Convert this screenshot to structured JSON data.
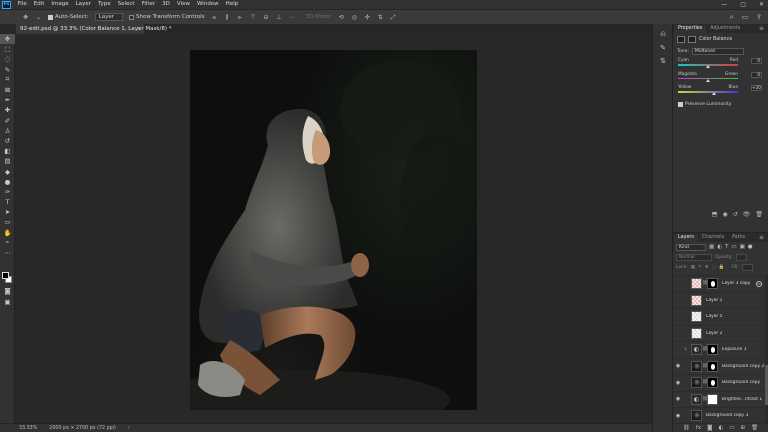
{
  "app": {
    "logo": "Ps"
  },
  "menu": [
    "File",
    "Edit",
    "Image",
    "Layer",
    "Type",
    "Select",
    "Filter",
    "3D",
    "View",
    "Window",
    "Help"
  ],
  "window_controls": [
    "—",
    "▢",
    "✕"
  ],
  "options": {
    "auto_select_label": "Auto-Select:",
    "auto_select_value": "Layer",
    "show_transform_label": "Show Transform Controls",
    "mode_3d_label": "3D Mode:",
    "right_icons": [
      "search-icon",
      "workspace-icon",
      "share-icon"
    ]
  },
  "document_tab": {
    "title": "92-edit.psd @ 33.3% (Color Balance 1, Layer Mask/8) *",
    "close": "×"
  },
  "status": {
    "zoom": "33.33%",
    "doc_size": "2000 px × 2700 px (72 ppi)"
  },
  "properties": {
    "tabs": [
      "Properties",
      "Adjustments"
    ],
    "title": "Color Balance",
    "tone_label": "Tone:",
    "tone_value": "Midtones",
    "sliders": [
      {
        "left": "Cyan",
        "right": "Red",
        "value": "0",
        "thumb": 0.5,
        "gradient": [
          "#19c8c8",
          "#d23c3c"
        ]
      },
      {
        "left": "Magenta",
        "right": "Green",
        "value": "0",
        "thumb": 0.5,
        "gradient": [
          "#c83cc8",
          "#3cc83c"
        ]
      },
      {
        "left": "Yellow",
        "right": "Blue",
        "value": "+20",
        "thumb": 0.6,
        "gradient": [
          "#d2d23c",
          "#3c3cd2"
        ]
      }
    ],
    "preserve_label": "Preserve Luminosity",
    "preserve_checked": true
  },
  "layers_panel": {
    "tabs": [
      "Layers",
      "Channels",
      "Paths"
    ],
    "kind_label": "Kind",
    "blend_mode": "Normal",
    "opacity_label": "Opacity:",
    "fill_label": "Fill:",
    "lock_label": "Lock:",
    "layers": [
      {
        "name": "Layer 3 copy",
        "visible": false,
        "thumb": "checker-pink",
        "mask": "mask-b",
        "fx": true,
        "selected": false,
        "clipped": false
      },
      {
        "name": "Layer 1",
        "visible": false,
        "thumb": "checker-pink",
        "mask": "",
        "fx": false,
        "selected": false,
        "clipped": false
      },
      {
        "name": "Layer 5",
        "visible": false,
        "thumb": "checker",
        "mask": "",
        "fx": false,
        "selected": false,
        "clipped": false
      },
      {
        "name": "Layer 2",
        "visible": false,
        "thumb": "checker",
        "mask": "",
        "fx": false,
        "selected": false,
        "clipped": false
      },
      {
        "name": "Exposure 1",
        "visible": false,
        "thumb": "adj",
        "mask": "mask-b",
        "fx": false,
        "selected": false,
        "clipped": true
      },
      {
        "name": "Background copy 2",
        "visible": true,
        "thumb": "photo-t",
        "mask": "mask-b",
        "fx": false,
        "selected": false,
        "clipped": false
      },
      {
        "name": "Background copy",
        "visible": true,
        "thumb": "photo-t",
        "mask": "mask-b",
        "fx": false,
        "selected": false,
        "clipped": false
      },
      {
        "name": "Brightne...ntrast 1",
        "visible": true,
        "thumb": "adj",
        "mask": "mask-w",
        "fx": false,
        "selected": false,
        "clipped": false
      },
      {
        "name": "Background copy 3",
        "visible": true,
        "thumb": "photo-t",
        "mask": "",
        "fx": false,
        "selected": false,
        "clipped": false
      }
    ]
  }
}
